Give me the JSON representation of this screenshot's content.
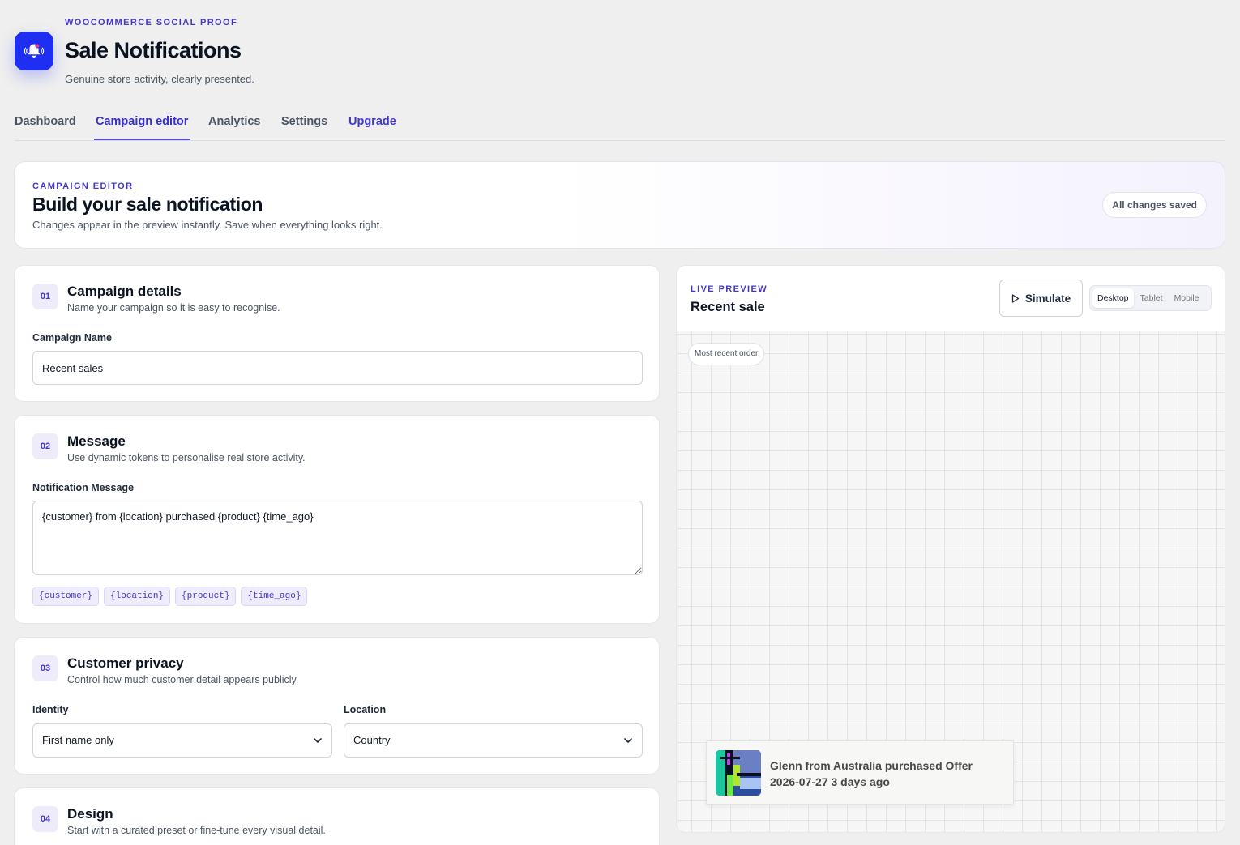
{
  "app": {
    "eyebrow": "WOOCOMMERCE SOCIAL PROOF",
    "title": "Sale Notifications",
    "subtitle": "Genuine store activity, clearly presented.",
    "logo_icon": "bell-icon",
    "brand_color": "#1f2ff2"
  },
  "tabs": [
    {
      "label": "Dashboard"
    },
    {
      "label": "Campaign editor"
    },
    {
      "label": "Analytics"
    },
    {
      "label": "Settings"
    },
    {
      "label": "Upgrade"
    }
  ],
  "active_tab": "Campaign editor",
  "banner": {
    "eyebrow": "CAMPAIGN EDITOR",
    "title": "Build your sale notification",
    "subtitle": "Changes appear in the preview instantly. Save when everything looks right.",
    "status": "All changes saved"
  },
  "sections": {
    "details": {
      "step": "01",
      "title": "Campaign details",
      "description": "Name your campaign so it is easy to recognise.",
      "name_label": "Campaign Name",
      "name_value": "Recent sales"
    },
    "message": {
      "step": "02",
      "title": "Message",
      "description": "Use dynamic tokens to personalise real store activity.",
      "message_label": "Notification Message",
      "message_value": "{customer} from {location} purchased {product} {time_ago}",
      "tokens": [
        "{customer}",
        "{location}",
        "{product}",
        "{time_ago}"
      ]
    },
    "privacy": {
      "step": "03",
      "title": "Customer privacy",
      "description": "Control how much customer detail appears publicly.",
      "identity_label": "Identity",
      "identity_value": "First name only",
      "location_label": "Location",
      "location_value": "Country"
    },
    "design": {
      "step": "04",
      "title": "Design",
      "description": "Start with a curated preset or fine-tune every visual detail."
    }
  },
  "preview": {
    "eyebrow": "LIVE PREVIEW",
    "title": "Recent sale",
    "simulate_label": "Simulate",
    "devices": [
      "Desktop",
      "Tablet",
      "Mobile"
    ],
    "active_device": "Desktop",
    "canvas_label": "Most recent order",
    "notification_text": "Glenn from Australia purchased Offer 2026-07-27 3 days ago"
  }
}
